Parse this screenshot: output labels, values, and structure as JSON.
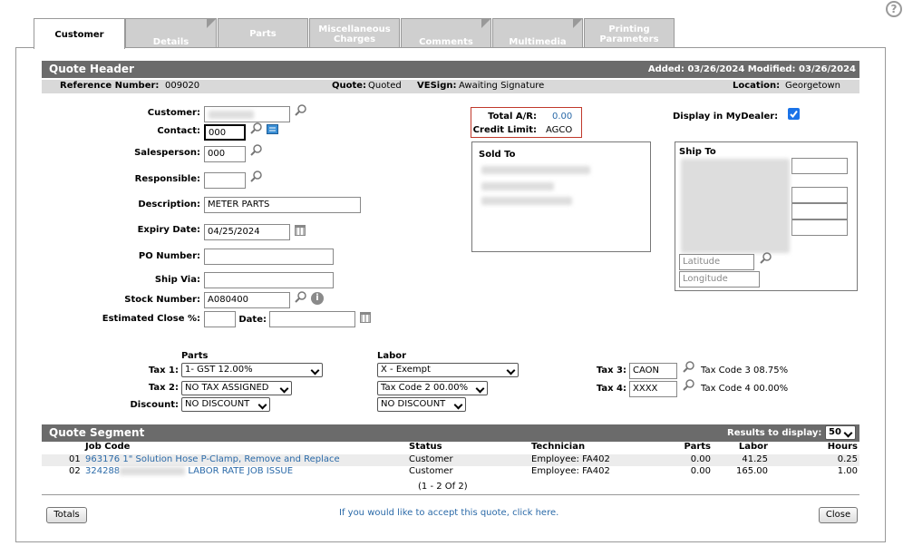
{
  "tabs": [
    {
      "label": "Customer"
    },
    {
      "label": "Details"
    },
    {
      "label": "Parts"
    },
    {
      "label": "Miscellaneous Charges",
      "l1": "Miscellaneous",
      "l2": "Charges"
    },
    {
      "label": "Comments"
    },
    {
      "label": "Multimedia"
    },
    {
      "label": "Printing Parameters",
      "l1": "Printing",
      "l2": "Parameters"
    }
  ],
  "header": {
    "title": "Quote Header",
    "added_label": "Added:",
    "added": "03/26/2024",
    "modified_label": "Modified:",
    "modified": "03/26/2024"
  },
  "refrow": {
    "ref_label": "Reference Number:",
    "ref": "009020",
    "quote_label": "Quote:",
    "quote": "Quoted",
    "vesign_label": "VESign:",
    "vesign": "Awaiting Signature",
    "location_label": "Location:",
    "location": "Georgetown"
  },
  "form": {
    "customer_label": "Customer:",
    "contact_label": "Contact:",
    "contact": "000",
    "salesperson_label": "Salesperson:",
    "salesperson": "000",
    "responsible_label": "Responsible:",
    "description_label": "Description:",
    "description": "METER PARTS",
    "expiry_label": "Expiry Date:",
    "expiry": "04/25/2024",
    "po_label": "PO Number:",
    "shipvia_label": "Ship Via:",
    "stock_label": "Stock Number:",
    "stock": "A080400",
    "close_label": "Estimated Close %:",
    "date_label": "Date:"
  },
  "ar": {
    "total_label": "Total A/R:",
    "total": "0.00",
    "credit_label": "Credit Limit:",
    "credit": "AGCO"
  },
  "mydealer_label": "Display in MyDealer:",
  "sold_to_label": "Sold To",
  "ship_to": {
    "label": "Ship To",
    "latitude_placeholder": "Latitude",
    "longitude_placeholder": "Longitude"
  },
  "tax": {
    "parts_label": "Parts",
    "labor_label": "Labor",
    "tax1_label": "Tax 1:",
    "tax2_label": "Tax 2:",
    "discount_label": "Discount:",
    "parts_tax1": "1- GST 12.00%",
    "parts_tax2": "NO TAX ASSIGNED",
    "parts_discount": "NO DISCOUNT",
    "labor_tax1": "X - Exempt",
    "labor_tax2": "Tax Code 2 00.00%",
    "labor_discount": "NO DISCOUNT",
    "tax3_label": "Tax 3:",
    "tax3": "CAON",
    "tax3_desc": "Tax Code 3 08.75%",
    "tax4_label": "Tax 4:",
    "tax4": "XXXX",
    "tax4_desc": "Tax Code 4 00.00%"
  },
  "segment": {
    "title": "Quote Segment",
    "results_label": "Results to display:",
    "results": "50",
    "columns": {
      "job": "Job Code",
      "status": "Status",
      "tech": "Technician",
      "parts": "Parts",
      "labor": "Labor",
      "hours": "Hours"
    },
    "rows": [
      {
        "num": "01",
        "code": "963176",
        "desc": "1\" Solution Hose P-Clamp, Remove and Replace",
        "status": "Customer",
        "tech": "Employee: FA402",
        "parts": "0.00",
        "labor": "41.25",
        "hours": "0.25"
      },
      {
        "num": "02",
        "code": "324288",
        "desc": "LABOR RATE JOB ISSUE",
        "status": "Customer",
        "tech": "Employee: FA402",
        "parts": "0.00",
        "labor": "165.00",
        "hours": "1.00"
      }
    ],
    "pager": "(1 - 2 Of 2)"
  },
  "footer": {
    "totals": "Totals",
    "accept": "If you would like to accept this quote, click here.",
    "close": "Close"
  },
  "colors": {
    "header": "#6b6b6b",
    "link": "#2b6aa8",
    "ar_border": "#c0392b",
    "checkbox": "#1a73e8"
  },
  "icons": [
    "help-icon",
    "search-icon",
    "contact-card-icon",
    "calendar-icon",
    "info-icon",
    "checkbox-checked-icon"
  ]
}
